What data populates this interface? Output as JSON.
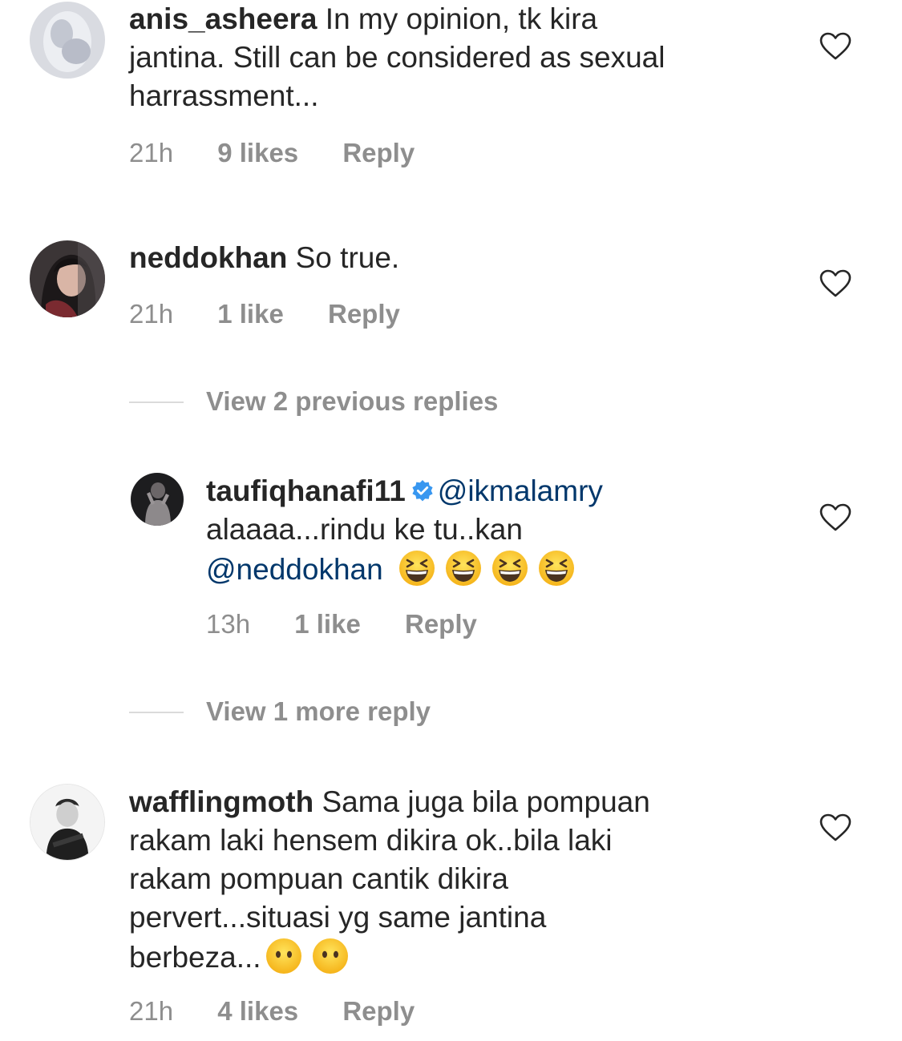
{
  "comments": [
    {
      "username": "anis_asheera",
      "text_line1": " In my opinion, tk kira",
      "text_line2": "jantina. Still can be considered as sexual",
      "text_line3": "harrassment...",
      "time": "21h",
      "likes": "9 likes",
      "reply": "Reply"
    },
    {
      "username": "neddokhan",
      "text_line1": " So true.",
      "time": "21h",
      "likes": "1 like",
      "reply": "Reply"
    },
    {
      "username": "wafflingmoth",
      "text_line1": " Sama juga bila pompuan",
      "text_line2": "rakam laki hensem dikira ok..bila laki",
      "text_line3": "rakam pompuan cantik dikira",
      "text_line4": "pervert...situasi yg same jantina",
      "text_line5": "berbeza...",
      "time": "21h",
      "likes": "4 likes",
      "reply": "Reply"
    }
  ],
  "view_previous_replies": "View 2 previous replies",
  "reply": {
    "username": "taufiqhanafi11",
    "mention1": "@ikmalamry",
    "text_line2": "alaaaa...rindu ke tu..kan",
    "mention2": "@neddokhan",
    "time": "13h",
    "likes": "1 like",
    "reply": "Reply"
  },
  "view_more_reply": "View 1 more reply",
  "icons": {
    "like": "heart-outline-icon",
    "verified": "verified-badge-icon",
    "laughing_emoji": "grinning-squinting-face-emoji",
    "no_mouth_emoji": "face-without-mouth-emoji"
  },
  "colors": {
    "text": "#262626",
    "muted": "#8e8e8e",
    "mention": "#00376b",
    "verified": "#3897f0",
    "divider": "#dbdbdb"
  }
}
